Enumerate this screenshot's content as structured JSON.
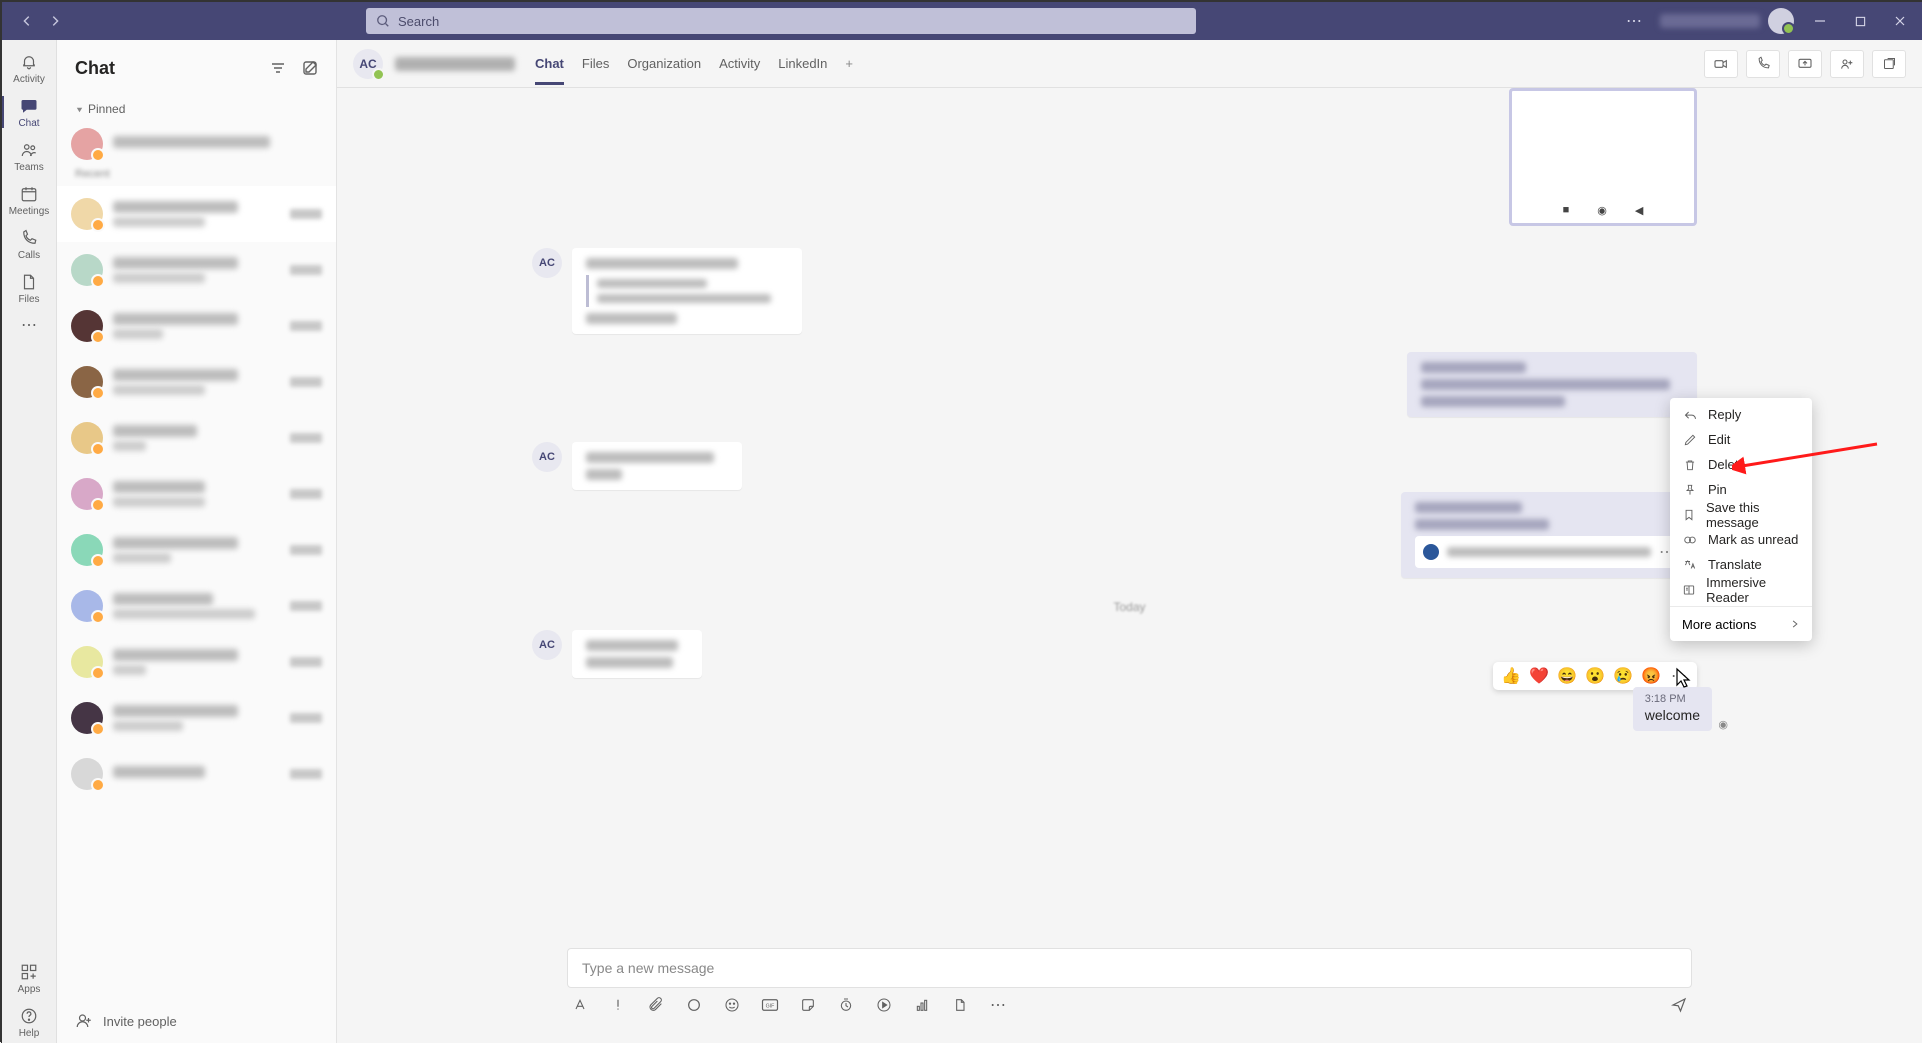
{
  "search": {
    "placeholder": "Search"
  },
  "rail": {
    "activity": "Activity",
    "chat": "Chat",
    "teams": "Teams",
    "meetings": "Meetings",
    "calls": "Calls",
    "files": "Files",
    "apps": "Apps",
    "help": "Help"
  },
  "sidebar": {
    "title": "Chat",
    "pinned_label": "Pinned",
    "invite_label": "Invite people"
  },
  "chat_header": {
    "avatar_initials": "AC",
    "tabs": {
      "chat": "Chat",
      "files": "Files",
      "organization": "Organization",
      "activity": "Activity",
      "linkedin": "LinkedIn"
    }
  },
  "context_menu": {
    "reply": "Reply",
    "edit": "Edit",
    "delete": "Delete",
    "pin": "Pin",
    "save": "Save this message",
    "mark_unread": "Mark as unread",
    "translate": "Translate",
    "immersive": "Immersive Reader",
    "more": "More actions"
  },
  "reactions": {
    "like": "👍",
    "heart": "❤️",
    "laugh": "😄",
    "surprised": "😮",
    "sad": "😢",
    "angry": "😡"
  },
  "welcome_msg": {
    "time": "3:18 PM",
    "text": "welcome"
  },
  "composer": {
    "placeholder": "Type a new message"
  },
  "msg_initials": "AC"
}
